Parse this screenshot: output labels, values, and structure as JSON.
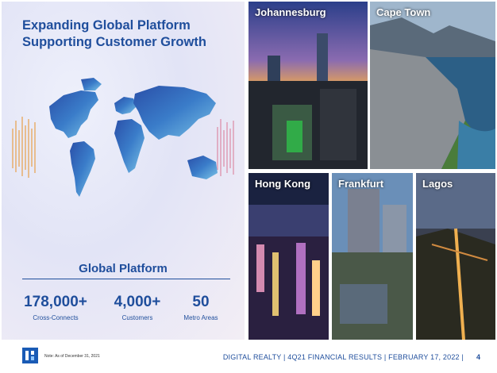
{
  "title_line1": "Expanding Global Platform",
  "title_line2": "Supporting Customer Growth",
  "section_title": "Global Platform",
  "stats": [
    {
      "value": "178,000+",
      "label": "Cross-Connects"
    },
    {
      "value": "4,000+",
      "label": "Customers"
    },
    {
      "value": "50",
      "label": "Metro Areas"
    }
  ],
  "cities": [
    "Johannesburg",
    "Cape Town",
    "Hong Kong",
    "Frankfurt",
    "Lagos"
  ],
  "footer": {
    "note": "Note: As of December 31, 2021",
    "text": "DIGITAL REALTY | 4Q21 FINANCIAL RESULTS | FEBRUARY 17, 2022 |",
    "page": "4"
  },
  "colors": {
    "brand_blue": "#1f4e9c",
    "logo_blue": "#1a5bb5"
  }
}
